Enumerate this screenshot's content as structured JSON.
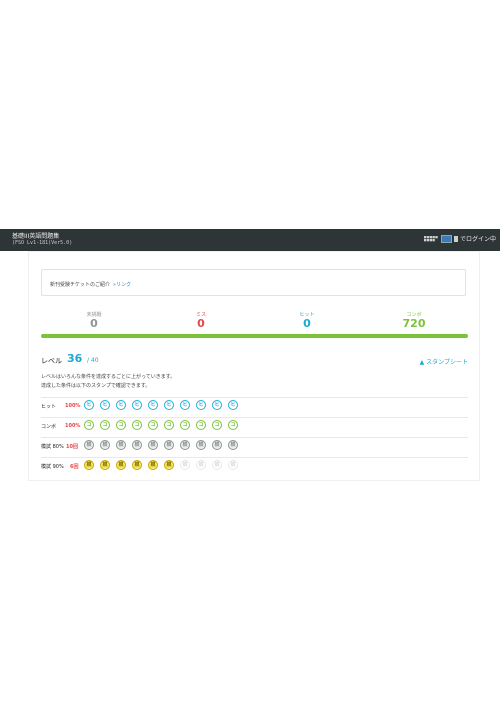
{
  "header": {
    "title": "基礎III英語問題集",
    "subtitle": "(FSO Lv1-181(Ver5.0)",
    "user_mini_lines": [
      "■■■■■",
      "■■■■"
    ],
    "login_text": "でログイン中",
    "background": "#2e3536"
  },
  "notice": {
    "text": "新刊受験チケットのご紹介",
    "link_label": "»リンク"
  },
  "stats": [
    {
      "label": "未挑戦",
      "value": "0",
      "color": "#8d9595"
    },
    {
      "label": "ミス",
      "value": "0",
      "color": "#e5474a"
    },
    {
      "label": "ヒット",
      "value": "0",
      "color": "#1aaad0"
    },
    {
      "label": "コンボ",
      "value": "720",
      "color": "#7ac33a"
    }
  ],
  "progress": {
    "fraction": 1.0,
    "color": "#7ac33a"
  },
  "level": {
    "title": "レベル",
    "value": "36",
    "max": "/ 40",
    "stamp_sheet_link": "▲ スタンプシート"
  },
  "description": [
    "レベルはいろんな条件を達成するごとに上がっていきます。",
    "達成した条件は以下のスタンプで確認できます。"
  ],
  "stamp_rows": [
    {
      "label": "ヒット",
      "pct": "100%",
      "count": "",
      "style": "hit",
      "glyph": "ヒ",
      "filled": 10,
      "total": 10
    },
    {
      "label": "コンボ",
      "pct": "100%",
      "count": "",
      "style": "combo",
      "glyph": "コ",
      "filled": 10,
      "total": 10
    },
    {
      "label": "模試 80%",
      "pct": "",
      "count": "10回",
      "style": "gray",
      "glyph": "模",
      "filled": 10,
      "total": 10
    },
    {
      "label": "模試 90%",
      "pct": "",
      "count": "6回",
      "style": "gold",
      "glyph": "模",
      "filled": 6,
      "total": 10
    }
  ]
}
